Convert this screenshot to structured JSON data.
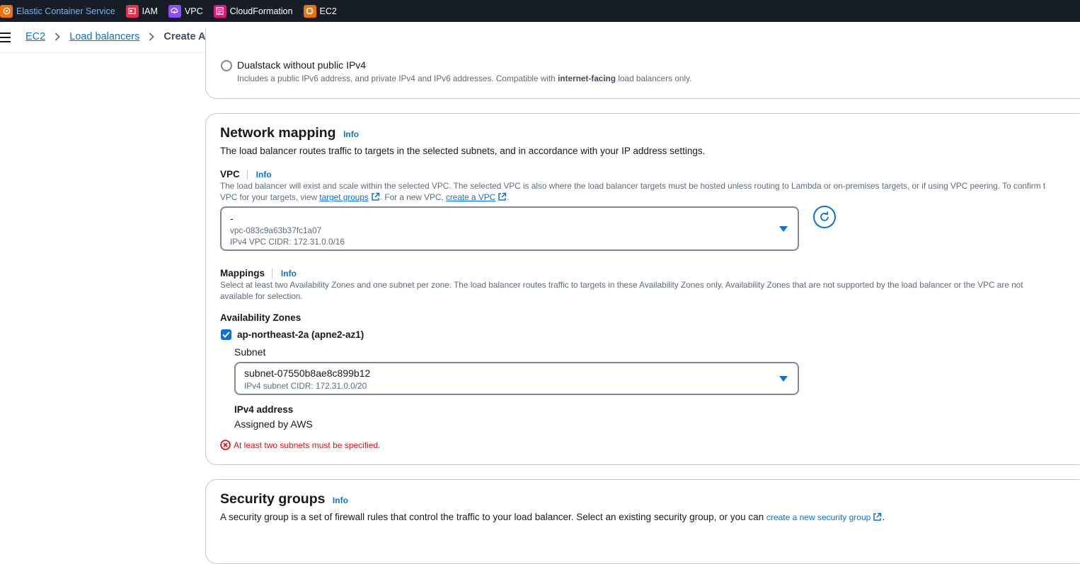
{
  "topbar": {
    "services": [
      {
        "label": "Elastic Container Service",
        "icon": "ecs-icon",
        "color": "#e7740e"
      },
      {
        "label": "IAM",
        "icon": "iam-icon",
        "color": "#dd344c"
      },
      {
        "label": "VPC",
        "icon": "vpc-icon",
        "color": "#8c4fff"
      },
      {
        "label": "CloudFormation",
        "icon": "cloudformation-icon",
        "color": "#e7157b"
      },
      {
        "label": "EC2",
        "icon": "ec2-icon",
        "color": "#ed7100"
      }
    ]
  },
  "breadcrumb": {
    "items": [
      "EC2",
      "Load balancers"
    ],
    "current": "Create Application Load Balancer"
  },
  "ip_type": {
    "option_label": "Dualstack without public IPv4",
    "option_desc_prefix": "Includes a public IPv6 address, and private IPv4 and IPv6 addresses. Compatible with ",
    "option_desc_bold": "internet-facing",
    "option_desc_suffix": " load balancers only."
  },
  "network": {
    "title": "Network mapping",
    "info": "Info",
    "desc": "The load balancer routes traffic to targets in the selected subnets, and in accordance with your IP address settings.",
    "vpc_label": "VPC",
    "vpc_info": "Info",
    "vpc_desc_line1": "The load balancer will exist and scale within the selected VPC. The selected VPC is also where the load balancer targets must be hosted unless routing to Lambda or on-premises targets, or if using VPC peering. To confirm t",
    "vpc_desc_line2_prefix": "VPC for your targets, view ",
    "vpc_desc_link1": "target groups",
    "vpc_desc_mid": ". For a new VPC, ",
    "vpc_desc_link2": "create a VPC",
    "vpc_desc_end": ".",
    "vpc_select": {
      "name": "-",
      "id": "vpc-083c9a63b37fc1a07",
      "cidr": "IPv4 VPC CIDR: 172.31.0.0/16"
    },
    "mappings_label": "Mappings",
    "mappings_info": "Info",
    "mappings_desc_line1": "Select at least two Availability Zones and one subnet per zone. The load balancer routes traffic to targets in these Availability Zones only. Availability Zones that are not supported by the load balancer or the VPC are not",
    "mappings_desc_line2": "available for selection.",
    "az_label": "Availability Zones",
    "az_item": "ap-northeast-2a (apne2-az1)",
    "az_checked": true,
    "subnet_label": "Subnet",
    "subnet_select": {
      "id": "subnet-07550b8ae8c899b12",
      "cidr": "IPv4 subnet CIDR: 172.31.0.0/20"
    },
    "ipv4_label": "IPv4 address",
    "ipv4_value": "Assigned by AWS",
    "error": "At least two subnets must be specified."
  },
  "security": {
    "title": "Security groups",
    "info": "Info",
    "desc_prefix": "A security group is a set of firewall rules that control the traffic to your load balancer. Select an existing security group, or you can ",
    "desc_link": "create a new security group",
    "desc_end": "."
  }
}
